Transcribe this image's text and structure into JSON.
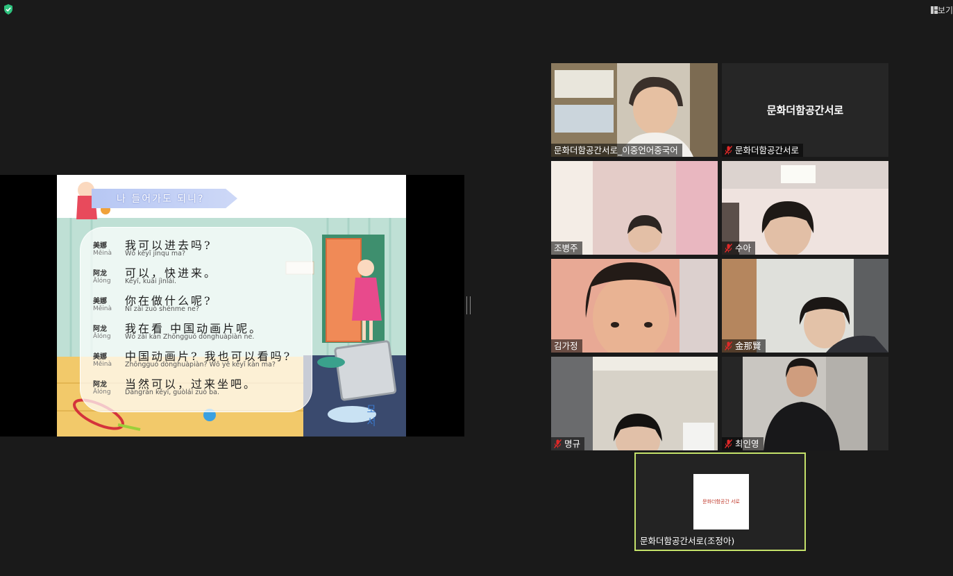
{
  "toolbar": {
    "view_label": "보기"
  },
  "share": {
    "banner": "나 들어가도 되니?",
    "lines": [
      {
        "speaker": "美娜",
        "speaker_py": "Měinà",
        "zh": "我可以进去吗?",
        "py": "Wǒ kěyǐ  jìnqu ma?"
      },
      {
        "speaker": "阿龙",
        "speaker_py": "Ālóng",
        "zh": "可以，快进来。",
        "py": "Kěyǐ,   kuài jìnlái."
      },
      {
        "speaker": "美娜",
        "speaker_py": "Měinà",
        "zh": "你在做什么呢?",
        "py": "Nǐ zài zuò shénme ne?"
      },
      {
        "speaker": "阿龙",
        "speaker_py": "Ālóng",
        "zh": "我在看 中国动画片呢。",
        "py": "Wǒ zài kàn Zhōngguó dònghuàpiàn ne."
      },
      {
        "speaker": "美娜",
        "speaker_py": "Měinà",
        "zh": "中国动画片? 我也可以看吗?",
        "py": "Zhōngguó dònghuàpiàn?  Wǒ yě  kěyǐ  kàn ma?"
      },
      {
        "speaker": "阿龙",
        "speaker_py": "Ālóng",
        "zh": "当然可以，过来坐吧。",
        "py": "Dāngrán kěyǐ,      guòlái zuò ba."
      }
    ],
    "sign_text": "모 서"
  },
  "participants": [
    {
      "name": "문화더함공간서로_이중언어중국어",
      "muted": false
    },
    {
      "name": "문화더함공간서로",
      "muted": true,
      "center": "문화더함공간서로"
    },
    {
      "name": "조병주",
      "muted": false
    },
    {
      "name": "수아",
      "muted": true
    },
    {
      "name": "김가정",
      "muted": false
    },
    {
      "name": "金那賢",
      "muted": true
    },
    {
      "name": "명규",
      "muted": true
    },
    {
      "name": "최인영",
      "muted": true
    }
  ],
  "active_speaker": {
    "name": "문화더함공간서로(조정아)",
    "logo_text": "문화더함공간 서로"
  },
  "colors": {
    "background": "#1a1a1a",
    "active_border": "#c5e26a",
    "mute_red": "#e02828",
    "shield_green": "#2ec27e"
  }
}
